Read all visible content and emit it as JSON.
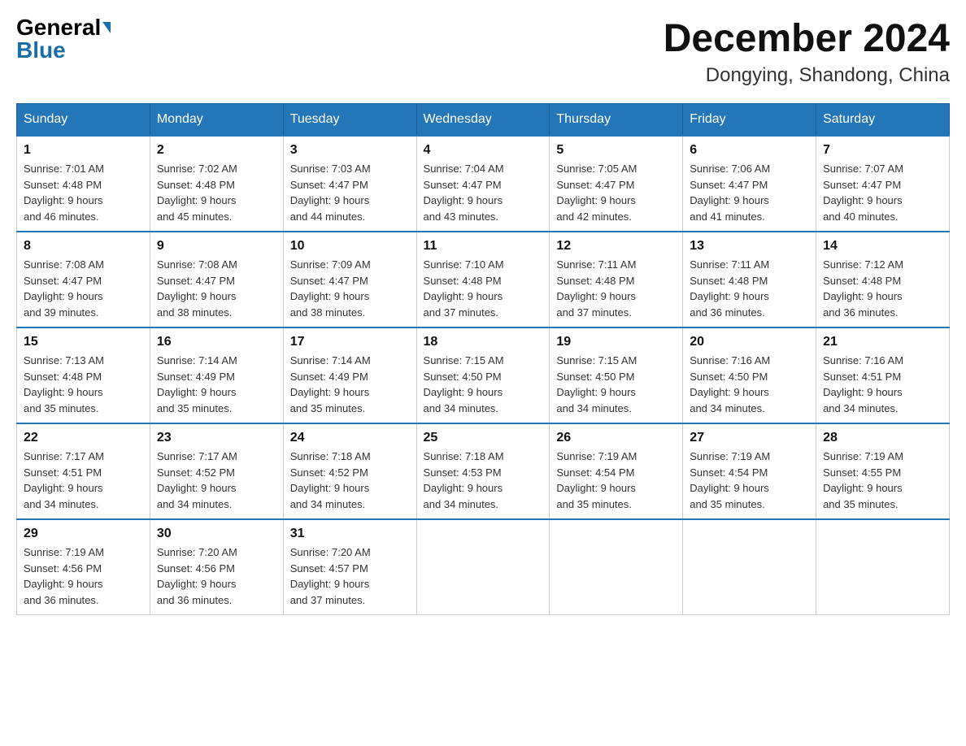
{
  "header": {
    "logo_general": "General",
    "logo_blue": "Blue",
    "month_title": "December 2024",
    "location": "Dongying, Shandong, China"
  },
  "weekdays": [
    "Sunday",
    "Monday",
    "Tuesday",
    "Wednesday",
    "Thursday",
    "Friday",
    "Saturday"
  ],
  "weeks": [
    [
      {
        "day": "1",
        "sunrise": "7:01 AM",
        "sunset": "4:48 PM",
        "daylight": "9 hours and 46 minutes."
      },
      {
        "day": "2",
        "sunrise": "7:02 AM",
        "sunset": "4:48 PM",
        "daylight": "9 hours and 45 minutes."
      },
      {
        "day": "3",
        "sunrise": "7:03 AM",
        "sunset": "4:47 PM",
        "daylight": "9 hours and 44 minutes."
      },
      {
        "day": "4",
        "sunrise": "7:04 AM",
        "sunset": "4:47 PM",
        "daylight": "9 hours and 43 minutes."
      },
      {
        "day": "5",
        "sunrise": "7:05 AM",
        "sunset": "4:47 PM",
        "daylight": "9 hours and 42 minutes."
      },
      {
        "day": "6",
        "sunrise": "7:06 AM",
        "sunset": "4:47 PM",
        "daylight": "9 hours and 41 minutes."
      },
      {
        "day": "7",
        "sunrise": "7:07 AM",
        "sunset": "4:47 PM",
        "daylight": "9 hours and 40 minutes."
      }
    ],
    [
      {
        "day": "8",
        "sunrise": "7:08 AM",
        "sunset": "4:47 PM",
        "daylight": "9 hours and 39 minutes."
      },
      {
        "day": "9",
        "sunrise": "7:08 AM",
        "sunset": "4:47 PM",
        "daylight": "9 hours and 38 minutes."
      },
      {
        "day": "10",
        "sunrise": "7:09 AM",
        "sunset": "4:47 PM",
        "daylight": "9 hours and 38 minutes."
      },
      {
        "day": "11",
        "sunrise": "7:10 AM",
        "sunset": "4:48 PM",
        "daylight": "9 hours and 37 minutes."
      },
      {
        "day": "12",
        "sunrise": "7:11 AM",
        "sunset": "4:48 PM",
        "daylight": "9 hours and 37 minutes."
      },
      {
        "day": "13",
        "sunrise": "7:11 AM",
        "sunset": "4:48 PM",
        "daylight": "9 hours and 36 minutes."
      },
      {
        "day": "14",
        "sunrise": "7:12 AM",
        "sunset": "4:48 PM",
        "daylight": "9 hours and 36 minutes."
      }
    ],
    [
      {
        "day": "15",
        "sunrise": "7:13 AM",
        "sunset": "4:48 PM",
        "daylight": "9 hours and 35 minutes."
      },
      {
        "day": "16",
        "sunrise": "7:14 AM",
        "sunset": "4:49 PM",
        "daylight": "9 hours and 35 minutes."
      },
      {
        "day": "17",
        "sunrise": "7:14 AM",
        "sunset": "4:49 PM",
        "daylight": "9 hours and 35 minutes."
      },
      {
        "day": "18",
        "sunrise": "7:15 AM",
        "sunset": "4:50 PM",
        "daylight": "9 hours and 34 minutes."
      },
      {
        "day": "19",
        "sunrise": "7:15 AM",
        "sunset": "4:50 PM",
        "daylight": "9 hours and 34 minutes."
      },
      {
        "day": "20",
        "sunrise": "7:16 AM",
        "sunset": "4:50 PM",
        "daylight": "9 hours and 34 minutes."
      },
      {
        "day": "21",
        "sunrise": "7:16 AM",
        "sunset": "4:51 PM",
        "daylight": "9 hours and 34 minutes."
      }
    ],
    [
      {
        "day": "22",
        "sunrise": "7:17 AM",
        "sunset": "4:51 PM",
        "daylight": "9 hours and 34 minutes."
      },
      {
        "day": "23",
        "sunrise": "7:17 AM",
        "sunset": "4:52 PM",
        "daylight": "9 hours and 34 minutes."
      },
      {
        "day": "24",
        "sunrise": "7:18 AM",
        "sunset": "4:52 PM",
        "daylight": "9 hours and 34 minutes."
      },
      {
        "day": "25",
        "sunrise": "7:18 AM",
        "sunset": "4:53 PM",
        "daylight": "9 hours and 34 minutes."
      },
      {
        "day": "26",
        "sunrise": "7:19 AM",
        "sunset": "4:54 PM",
        "daylight": "9 hours and 35 minutes."
      },
      {
        "day": "27",
        "sunrise": "7:19 AM",
        "sunset": "4:54 PM",
        "daylight": "9 hours and 35 minutes."
      },
      {
        "day": "28",
        "sunrise": "7:19 AM",
        "sunset": "4:55 PM",
        "daylight": "9 hours and 35 minutes."
      }
    ],
    [
      {
        "day": "29",
        "sunrise": "7:19 AM",
        "sunset": "4:56 PM",
        "daylight": "9 hours and 36 minutes."
      },
      {
        "day": "30",
        "sunrise": "7:20 AM",
        "sunset": "4:56 PM",
        "daylight": "9 hours and 36 minutes."
      },
      {
        "day": "31",
        "sunrise": "7:20 AM",
        "sunset": "4:57 PM",
        "daylight": "9 hours and 37 minutes."
      },
      null,
      null,
      null,
      null
    ]
  ],
  "labels": {
    "sunrise": "Sunrise:",
    "sunset": "Sunset:",
    "daylight": "Daylight:"
  }
}
